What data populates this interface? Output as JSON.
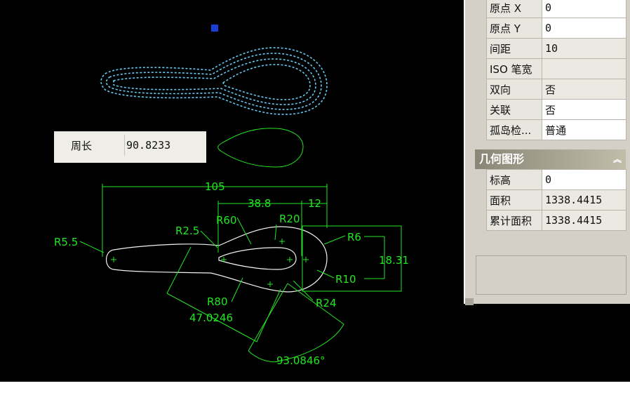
{
  "dimensions": {
    "overall_length": "105",
    "bowl_to_tip": "38.8",
    "tip_spacing": "12",
    "bowl_width": "18.31",
    "r5_5": "R5.5",
    "r2_5": "R2.5",
    "r60": "R60",
    "r20": "R20",
    "r6": "R6",
    "r10": "R10",
    "r24": "R24",
    "r80": "R80",
    "aligned_dim": "47.0246",
    "angle_dim": "93.0846°"
  },
  "perimeter_tooltip": {
    "label": "周长",
    "value": "90.8233"
  },
  "properties": {
    "hatch_rows": [
      {
        "key": "原点 X",
        "value": "0"
      },
      {
        "key": "原点 Y",
        "value": "0"
      },
      {
        "key": "间距",
        "value": "10"
      },
      {
        "key": "ISO 笔宽",
        "value": ""
      },
      {
        "key": "双向",
        "value": "否"
      },
      {
        "key": "关联",
        "value": "否"
      },
      {
        "key": "孤岛检...",
        "value": "普通"
      }
    ],
    "geometry_section": {
      "title": "几何图形",
      "collapse_icon": "chevron-up-icon",
      "rows": [
        {
          "key": "标高",
          "value": "0"
        },
        {
          "key": "面积",
          "value": "1338.4415"
        },
        {
          "key": "累计面积",
          "value": "1338.4415"
        }
      ]
    }
  },
  "colors": {
    "canvas": "#000000",
    "dimension": "#22e622",
    "geometry": "#f2f2f2",
    "hatch": "#66c8f0",
    "grip": "#1a3fd6"
  }
}
